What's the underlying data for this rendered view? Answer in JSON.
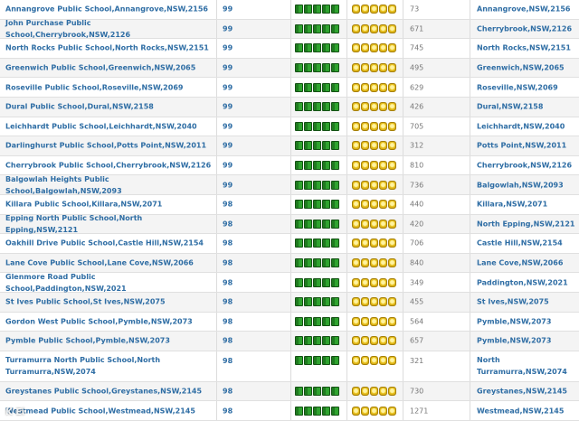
{
  "rows": [
    {
      "school": "Annangrove Public School,Annangrove,NSW,2156",
      "score": "99",
      "rank": "73",
      "suburb": "Annangrove,NSW,2156"
    },
    {
      "school": "John Purchase Public School,Cherrybrook,NSW,2126",
      "score": "99",
      "rank": "671",
      "suburb": "Cherrybrook,NSW,2126"
    },
    {
      "school": "North Rocks Public School,North Rocks,NSW,2151",
      "score": "99",
      "rank": "745",
      "suburb": "North Rocks,NSW,2151"
    },
    {
      "school": "Greenwich Public School,Greenwich,NSW,2065",
      "score": "99",
      "rank": "495",
      "suburb": "Greenwich,NSW,2065"
    },
    {
      "school": "Roseville Public School,Roseville,NSW,2069",
      "score": "99",
      "rank": "629",
      "suburb": "Roseville,NSW,2069"
    },
    {
      "school": "Dural Public School,Dural,NSW,2158",
      "score": "99",
      "rank": "426",
      "suburb": "Dural,NSW,2158"
    },
    {
      "school": "Leichhardt Public School,Leichhardt,NSW,2040",
      "score": "99",
      "rank": "705",
      "suburb": "Leichhardt,NSW,2040"
    },
    {
      "school": "Darlinghurst Public School,Potts Point,NSW,2011",
      "score": "99",
      "rank": "312",
      "suburb": "Potts Point,NSW,2011"
    },
    {
      "school": "Cherrybrook Public School,Cherrybrook,NSW,2126",
      "score": "99",
      "rank": "810",
      "suburb": "Cherrybrook,NSW,2126"
    },
    {
      "school": "Balgowlah Heights Public School,Balgowlah,NSW,2093",
      "score": "99",
      "rank": "736",
      "suburb": "Balgowlah,NSW,2093"
    },
    {
      "school": "Killara Public School,Killara,NSW,2071",
      "score": "98",
      "rank": "440",
      "suburb": "Killara,NSW,2071"
    },
    {
      "school": "Epping North Public School,North Epping,NSW,2121",
      "score": "98",
      "rank": "420",
      "suburb": "North Epping,NSW,2121"
    },
    {
      "school": "Oakhill Drive Public School,Castle Hill,NSW,2154",
      "score": "98",
      "rank": "706",
      "suburb": "Castle Hill,NSW,2154"
    },
    {
      "school": "Lane Cove Public School,Lane Cove,NSW,2066",
      "score": "98",
      "rank": "840",
      "suburb": "Lane Cove,NSW,2066"
    },
    {
      "school": "Glenmore Road Public School,Paddington,NSW,2021",
      "score": "98",
      "rank": "349",
      "suburb": "Paddington,NSW,2021"
    },
    {
      "school": "St Ives Public School,St Ives,NSW,2075",
      "score": "98",
      "rank": "455",
      "suburb": "St Ives,NSW,2075"
    },
    {
      "school": "Gordon West Public School,Pymble,NSW,2073",
      "score": "98",
      "rank": "564",
      "suburb": "Pymble,NSW,2073"
    },
    {
      "school": "Pymble Public School,Pymble,NSW,2073",
      "score": "98",
      "rank": "657",
      "suburb": "Pymble,NSW,2073"
    },
    {
      "school": "Turramurra North Public School,North Turramurra,NSW,2074",
      "score": "98",
      "rank": "321",
      "suburb": "North Turramurra,NSW,2074",
      "tall": true
    },
    {
      "school": "Greystanes Public School,Greystanes,NSW,2145",
      "score": "98",
      "rank": "730",
      "suburb": "Greystanes,NSW,2145"
    },
    {
      "school": "Westmead Public School,Westmead,NSW,2145",
      "score": "98",
      "rank": "1271",
      "suburb": "Westmead,NSW,2145"
    }
  ],
  "icons": {
    "rating_a": "green-book-icon",
    "rating_b": "gold-coin-icon"
  },
  "icon_count": 5,
  "colors": {
    "link": "#2e6da4",
    "row_alt": "#f4f4f4",
    "book": "#2fa32f",
    "coin": "#e8c21e"
  },
  "watermark": "K Ei"
}
